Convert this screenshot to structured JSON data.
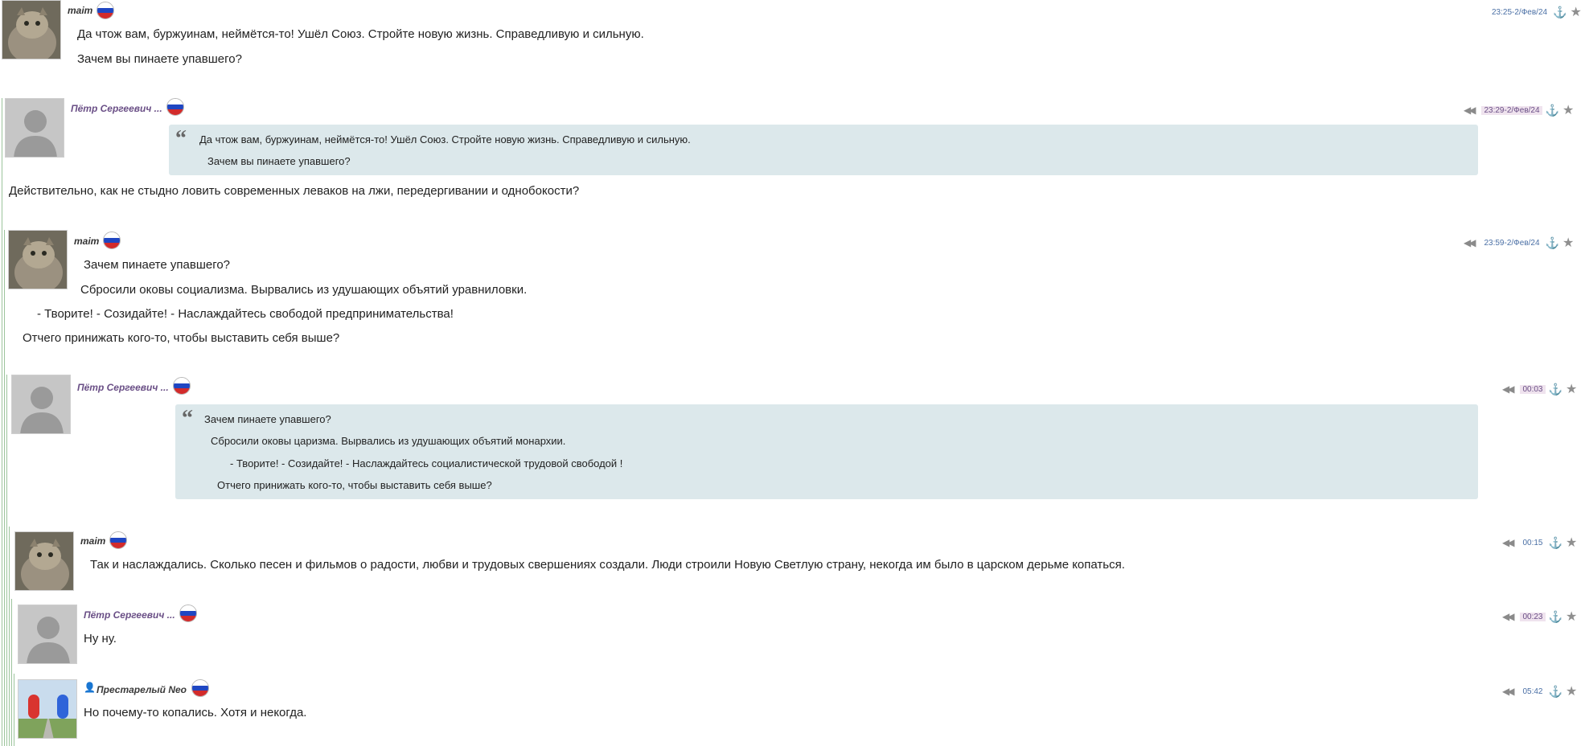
{
  "posts": [
    {
      "author": "maim",
      "timestamp": "23:25-2/Фев/24",
      "lines": [
        "Да чтож вам, буржуинам,  неймётся-то! Ушёл Союз. Стройте новую жизнь. Справедливую и сильную.",
        "Зачем вы пинаете упавшего?"
      ]
    },
    {
      "author": "Пётр Сергеевич ...",
      "timestamp": "23:29-2/Фев/24",
      "quote": [
        "Да чтож вам, буржуинам,  неймётся-то! Ушёл Союз. Стройте новую жизнь. Справедливую и сильную.",
        "Зачем вы пинаете упавшего?"
      ],
      "lines": [
        "Действительно, как не стыдно ловить современных леваков на лжи, передергивании и однобокости?"
      ]
    },
    {
      "author": "maim",
      "timestamp": "23:59-2/Фев/24",
      "lines": [
        "Зачем пинаете упавшего?",
        "Сбросили оковы социализма. Вырвались из удушающих объятий уравниловки.",
        "- Творите! - Созидайте! - Наслаждайтесь свободой предпринимательства!",
        "Отчего принижать кого-то, чтобы выставить себя выше?"
      ]
    },
    {
      "author": "Пётр Сергеевич ...",
      "timestamp": "00:03",
      "quote": [
        "Зачем пинаете упавшего?",
        "Сбросили оковы царизма. Вырвались из удушающих объятий монархии.",
        "- Творите! - Созидайте! - Наслаждайтесь социалистической трудовой свободой !",
        "Отчего принижать кого-то, чтобы выставить себя выше?"
      ],
      "lines": []
    },
    {
      "author": "maim",
      "timestamp": "00:15",
      "lines": [
        "Так и наслаждались. Сколько песен и фильмов о радости, любви и трудовых свершениях создали. Люди строили Новую Светлую страну, некогда им было в царском дерьме копаться."
      ]
    },
    {
      "author": "Пётр Сергеевич ...",
      "timestamp": "00:23",
      "lines": [
        "Ну ну."
      ]
    },
    {
      "author": "Престарелый Neo",
      "timestamp": "05:42",
      "lines": [
        "Но почему-то копались. Хотя и некогда."
      ]
    }
  ],
  "icons": {
    "reply": "double-left-arrow",
    "anchor": "anchor-icon",
    "favorite": "star-icon",
    "flag": "russia-flag",
    "user_badge": "user-icon"
  },
  "colors": {
    "quote_bg": "#dce8eb",
    "petr_name": "#6a4f86",
    "time_link": "#4a6fa5",
    "time_highlight": "#efe3ee",
    "thread_line": "#9cc49c"
  }
}
